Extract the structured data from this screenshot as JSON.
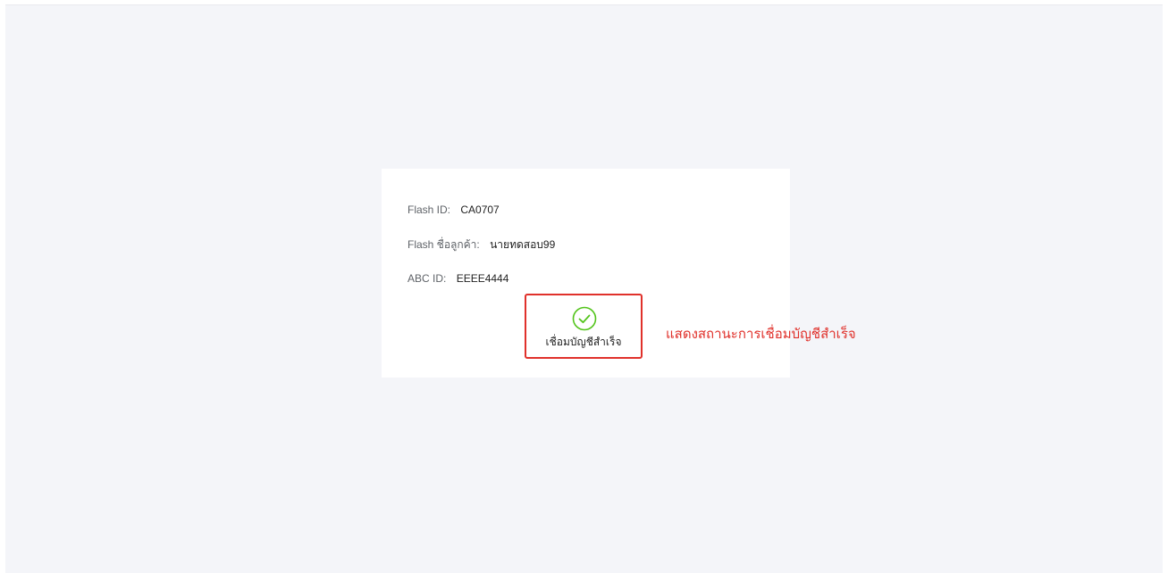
{
  "card": {
    "fields": [
      {
        "label": "Flash ID:",
        "value": "CA0707"
      },
      {
        "label": "Flash ชื่อลูกค้า:",
        "value": "นายทดสอบ99"
      },
      {
        "label": "ABC ID:",
        "value": "EEEE4444"
      }
    ],
    "status": {
      "icon": "check-circle-icon",
      "text": "เชื่อมบัญชีสำเร็จ",
      "color": "#52c41a"
    }
  },
  "annotation": {
    "text": "แสดงสถานะการเชื่อมบัญชีสำเร็จ",
    "color": "#e0312b"
  }
}
